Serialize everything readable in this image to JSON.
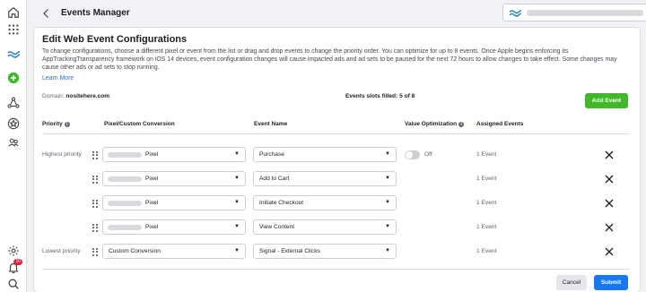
{
  "topbar": {
    "title": "Events Manager"
  },
  "card": {
    "title": "Edit Web Event Configurations",
    "description": "To change configurations, choose a different pixel or event from the list or drag and drop events to change the priority order. You can optimize for up to 8 events. Once Apple begins enforcing its AppTrackingTransparency framework on iOS 14 devices, event configuration changes will cause impacted ads and ad sets to be paused for the next 72 hours to allow changes to take effect. Some changes may cause other ads or ad sets to stop running.",
    "learn_more": "Learn More",
    "domain_label": "Domain:",
    "domain_value": "nositehere.com",
    "slots_filled": "Events slots filled: 5 of 8",
    "add_event": "Add Event"
  },
  "headers": {
    "priority": "Priority",
    "pixel": "Pixel/Custom Conversion",
    "event_name": "Event Name",
    "value_optimization": "Value Optimization",
    "assigned_events": "Assigned Events"
  },
  "rows": [
    {
      "priority": "Highest priority",
      "pixel": "Pixel",
      "event": "Purchase",
      "value_opt": "Off",
      "assigned": "1 Event"
    },
    {
      "priority": "",
      "pixel": "Pixel",
      "event": "Add to Cart",
      "assigned": "1 Event"
    },
    {
      "priority": "",
      "pixel": "Pixel",
      "event": "Initiate Checkout",
      "assigned": "1 Event"
    },
    {
      "priority": "",
      "pixel": "Pixel",
      "event": "View Content",
      "assigned": "1 Event"
    },
    {
      "priority": "Lowest priority",
      "pixel": "Custom Conversion",
      "event": "Signal - External Clicks",
      "assigned": "1 Event"
    }
  ],
  "footer": {
    "cancel": "Cancel",
    "submit": "Submit"
  },
  "nav": {
    "notification_count": "10"
  },
  "colors": {
    "primary": "#1877f2",
    "success": "#42b72a",
    "brand_wave": "#1a7fc1"
  }
}
